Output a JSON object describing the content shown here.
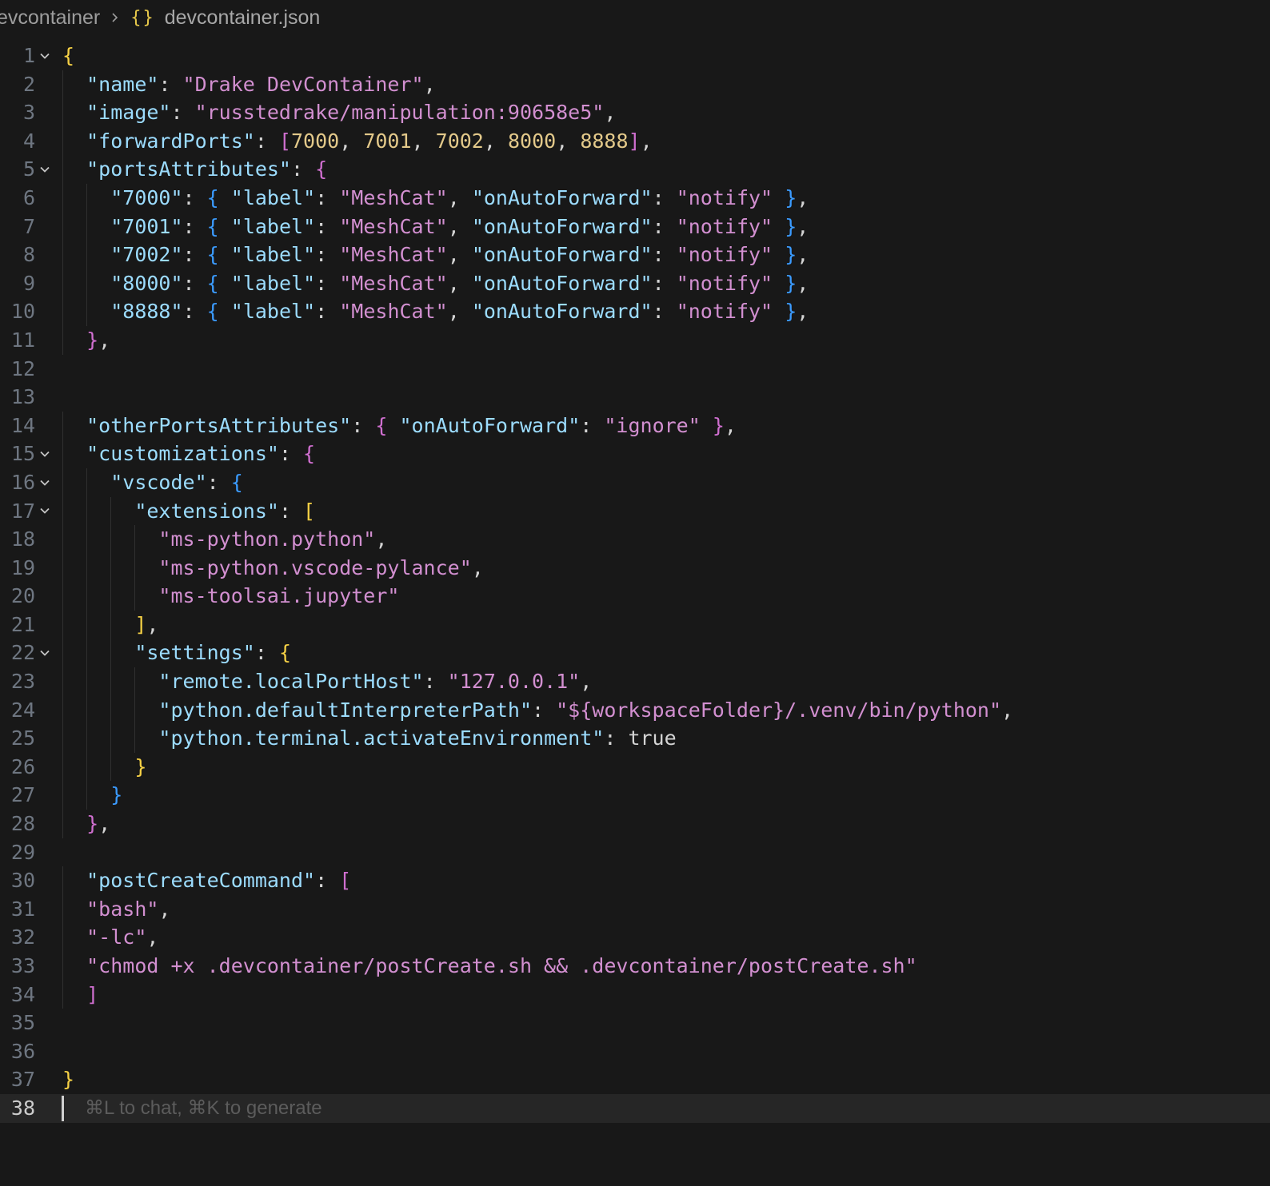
{
  "breadcrumb": {
    "folder": "evcontainer",
    "file_icon": "{}",
    "file": "devcontainer.json"
  },
  "colors": {
    "background": "#181818",
    "key": "#9cdcfe",
    "string": "#d28fd0",
    "number": "#e3c98a",
    "bracket_level1": "#f5d045",
    "bracket_level2": "#d06fd0",
    "bracket_level3": "#3b9bff"
  },
  "editor": {
    "current_line": 38,
    "ghost_hint": "⌘L to chat, ⌘K to generate",
    "lines": [
      {
        "n": "1",
        "fold": true,
        "tokens": [
          [
            "b1",
            "{"
          ]
        ]
      },
      {
        "n": "2",
        "fold": false,
        "tokens": [
          [
            "ind",
            "  "
          ],
          [
            "key",
            "\"name\""
          ],
          [
            "p",
            ": "
          ],
          [
            "s",
            "\"Drake DevContainer\""
          ],
          [
            "p",
            ","
          ]
        ]
      },
      {
        "n": "3",
        "fold": false,
        "tokens": [
          [
            "ind",
            "  "
          ],
          [
            "key",
            "\"image\""
          ],
          [
            "p",
            ": "
          ],
          [
            "s",
            "\"russtedrake/manipulation:90658e5\""
          ],
          [
            "p",
            ","
          ]
        ]
      },
      {
        "n": "4",
        "fold": false,
        "tokens": [
          [
            "ind",
            "  "
          ],
          [
            "key",
            "\"forwardPorts\""
          ],
          [
            "p",
            ": "
          ],
          [
            "b2",
            "["
          ],
          [
            "n",
            "7000"
          ],
          [
            "p",
            ", "
          ],
          [
            "n",
            "7001"
          ],
          [
            "p",
            ", "
          ],
          [
            "n",
            "7002"
          ],
          [
            "p",
            ", "
          ],
          [
            "n",
            "8000"
          ],
          [
            "p",
            ", "
          ],
          [
            "n",
            "8888"
          ],
          [
            "b2",
            "]"
          ],
          [
            "p",
            ","
          ]
        ]
      },
      {
        "n": "5",
        "fold": true,
        "tokens": [
          [
            "ind",
            "  "
          ],
          [
            "key",
            "\"portsAttributes\""
          ],
          [
            "p",
            ": "
          ],
          [
            "b2",
            "{"
          ]
        ]
      },
      {
        "n": "6",
        "fold": false,
        "tokens": [
          [
            "ind",
            "    "
          ],
          [
            "key",
            "\"7000\""
          ],
          [
            "p",
            ": "
          ],
          [
            "b3",
            "{"
          ],
          [
            "p",
            " "
          ],
          [
            "key",
            "\"label\""
          ],
          [
            "p",
            ": "
          ],
          [
            "s",
            "\"MeshCat\""
          ],
          [
            "p",
            ", "
          ],
          [
            "key",
            "\"onAutoForward\""
          ],
          [
            "p",
            ": "
          ],
          [
            "s",
            "\"notify\""
          ],
          [
            "p",
            " "
          ],
          [
            "b3",
            "}"
          ],
          [
            "p",
            ","
          ]
        ]
      },
      {
        "n": "7",
        "fold": false,
        "tokens": [
          [
            "ind",
            "    "
          ],
          [
            "key",
            "\"7001\""
          ],
          [
            "p",
            ": "
          ],
          [
            "b3",
            "{"
          ],
          [
            "p",
            " "
          ],
          [
            "key",
            "\"label\""
          ],
          [
            "p",
            ": "
          ],
          [
            "s",
            "\"MeshCat\""
          ],
          [
            "p",
            ", "
          ],
          [
            "key",
            "\"onAutoForward\""
          ],
          [
            "p",
            ": "
          ],
          [
            "s",
            "\"notify\""
          ],
          [
            "p",
            " "
          ],
          [
            "b3",
            "}"
          ],
          [
            "p",
            ","
          ]
        ]
      },
      {
        "n": "8",
        "fold": false,
        "tokens": [
          [
            "ind",
            "    "
          ],
          [
            "key",
            "\"7002\""
          ],
          [
            "p",
            ": "
          ],
          [
            "b3",
            "{"
          ],
          [
            "p",
            " "
          ],
          [
            "key",
            "\"label\""
          ],
          [
            "p",
            ": "
          ],
          [
            "s",
            "\"MeshCat\""
          ],
          [
            "p",
            ", "
          ],
          [
            "key",
            "\"onAutoForward\""
          ],
          [
            "p",
            ": "
          ],
          [
            "s",
            "\"notify\""
          ],
          [
            "p",
            " "
          ],
          [
            "b3",
            "}"
          ],
          [
            "p",
            ","
          ]
        ]
      },
      {
        "n": "9",
        "fold": false,
        "tokens": [
          [
            "ind",
            "    "
          ],
          [
            "key",
            "\"8000\""
          ],
          [
            "p",
            ": "
          ],
          [
            "b3",
            "{"
          ],
          [
            "p",
            " "
          ],
          [
            "key",
            "\"label\""
          ],
          [
            "p",
            ": "
          ],
          [
            "s",
            "\"MeshCat\""
          ],
          [
            "p",
            ", "
          ],
          [
            "key",
            "\"onAutoForward\""
          ],
          [
            "p",
            ": "
          ],
          [
            "s",
            "\"notify\""
          ],
          [
            "p",
            " "
          ],
          [
            "b3",
            "}"
          ],
          [
            "p",
            ","
          ]
        ]
      },
      {
        "n": "10",
        "fold": false,
        "tokens": [
          [
            "ind",
            "    "
          ],
          [
            "key",
            "\"8888\""
          ],
          [
            "p",
            ": "
          ],
          [
            "b3",
            "{"
          ],
          [
            "p",
            " "
          ],
          [
            "key",
            "\"label\""
          ],
          [
            "p",
            ": "
          ],
          [
            "s",
            "\"MeshCat\""
          ],
          [
            "p",
            ", "
          ],
          [
            "key",
            "\"onAutoForward\""
          ],
          [
            "p",
            ": "
          ],
          [
            "s",
            "\"notify\""
          ],
          [
            "p",
            " "
          ],
          [
            "b3",
            "}"
          ],
          [
            "p",
            ","
          ]
        ]
      },
      {
        "n": "11",
        "fold": false,
        "tokens": [
          [
            "ind",
            "  "
          ],
          [
            "b2",
            "}"
          ],
          [
            "p",
            ","
          ]
        ]
      },
      {
        "n": "12",
        "fold": false,
        "tokens": []
      },
      {
        "n": "13",
        "fold": false,
        "tokens": []
      },
      {
        "n": "14",
        "fold": false,
        "tokens": [
          [
            "ind",
            "  "
          ],
          [
            "key",
            "\"otherPortsAttributes\""
          ],
          [
            "p",
            ": "
          ],
          [
            "b2",
            "{"
          ],
          [
            "p",
            " "
          ],
          [
            "key",
            "\"onAutoForward\""
          ],
          [
            "p",
            ": "
          ],
          [
            "s",
            "\"ignore\""
          ],
          [
            "p",
            " "
          ],
          [
            "b2",
            "}"
          ],
          [
            "p",
            ","
          ]
        ]
      },
      {
        "n": "15",
        "fold": true,
        "tokens": [
          [
            "ind",
            "  "
          ],
          [
            "key",
            "\"customizations\""
          ],
          [
            "p",
            ": "
          ],
          [
            "b2",
            "{"
          ]
        ]
      },
      {
        "n": "16",
        "fold": true,
        "tokens": [
          [
            "ind",
            "    "
          ],
          [
            "key",
            "\"vscode\""
          ],
          [
            "p",
            ": "
          ],
          [
            "b3",
            "{"
          ]
        ]
      },
      {
        "n": "17",
        "fold": true,
        "tokens": [
          [
            "ind",
            "      "
          ],
          [
            "key",
            "\"extensions\""
          ],
          [
            "p",
            ": "
          ],
          [
            "b1",
            "["
          ]
        ]
      },
      {
        "n": "18",
        "fold": false,
        "tokens": [
          [
            "ind",
            "        "
          ],
          [
            "s",
            "\"ms-python.python\""
          ],
          [
            "p",
            ","
          ]
        ]
      },
      {
        "n": "19",
        "fold": false,
        "tokens": [
          [
            "ind",
            "        "
          ],
          [
            "s",
            "\"ms-python.vscode-pylance\""
          ],
          [
            "p",
            ","
          ]
        ]
      },
      {
        "n": "20",
        "fold": false,
        "tokens": [
          [
            "ind",
            "        "
          ],
          [
            "s",
            "\"ms-toolsai.jupyter\""
          ]
        ]
      },
      {
        "n": "21",
        "fold": false,
        "tokens": [
          [
            "ind",
            "      "
          ],
          [
            "b1",
            "]"
          ],
          [
            "p",
            ","
          ]
        ]
      },
      {
        "n": "22",
        "fold": true,
        "tokens": [
          [
            "ind",
            "      "
          ],
          [
            "key",
            "\"settings\""
          ],
          [
            "p",
            ": "
          ],
          [
            "b1",
            "{"
          ]
        ]
      },
      {
        "n": "23",
        "fold": false,
        "tokens": [
          [
            "ind",
            "        "
          ],
          [
            "key",
            "\"remote.localPortHost\""
          ],
          [
            "p",
            ": "
          ],
          [
            "s",
            "\"127.0.0.1\""
          ],
          [
            "p",
            ","
          ]
        ]
      },
      {
        "n": "24",
        "fold": false,
        "tokens": [
          [
            "ind",
            "        "
          ],
          [
            "key",
            "\"python.defaultInterpreterPath\""
          ],
          [
            "p",
            ": "
          ],
          [
            "s",
            "\"${workspaceFolder}/.venv/bin/python\""
          ],
          [
            "p",
            ","
          ]
        ]
      },
      {
        "n": "25",
        "fold": false,
        "tokens": [
          [
            "ind",
            "        "
          ],
          [
            "key",
            "\"python.terminal.activateEnvironment\""
          ],
          [
            "p",
            ": "
          ],
          [
            "kw",
            "true"
          ]
        ]
      },
      {
        "n": "26",
        "fold": false,
        "tokens": [
          [
            "ind",
            "      "
          ],
          [
            "b1",
            "}"
          ]
        ]
      },
      {
        "n": "27",
        "fold": false,
        "tokens": [
          [
            "ind",
            "    "
          ],
          [
            "b3",
            "}"
          ]
        ]
      },
      {
        "n": "28",
        "fold": false,
        "tokens": [
          [
            "ind",
            "  "
          ],
          [
            "b2",
            "}"
          ],
          [
            "p",
            ","
          ]
        ]
      },
      {
        "n": "29",
        "fold": false,
        "tokens": []
      },
      {
        "n": "30",
        "fold": false,
        "tokens": [
          [
            "ind",
            "  "
          ],
          [
            "key",
            "\"postCreateCommand\""
          ],
          [
            "p",
            ": "
          ],
          [
            "b2",
            "["
          ]
        ]
      },
      {
        "n": "31",
        "fold": false,
        "tokens": [
          [
            "ind",
            "  "
          ],
          [
            "s",
            "\"bash\""
          ],
          [
            "p",
            ","
          ]
        ]
      },
      {
        "n": "32",
        "fold": false,
        "tokens": [
          [
            "ind",
            "  "
          ],
          [
            "s",
            "\"-lc\""
          ],
          [
            "p",
            ","
          ]
        ]
      },
      {
        "n": "33",
        "fold": false,
        "tokens": [
          [
            "ind",
            "  "
          ],
          [
            "s",
            "\"chmod +x .devcontainer/postCreate.sh && .devcontainer/postCreate.sh\""
          ]
        ]
      },
      {
        "n": "34",
        "fold": false,
        "tokens": [
          [
            "ind",
            "  "
          ],
          [
            "b2",
            "]"
          ]
        ]
      },
      {
        "n": "35",
        "fold": false,
        "tokens": []
      },
      {
        "n": "36",
        "fold": false,
        "tokens": []
      },
      {
        "n": "37",
        "fold": false,
        "tokens": [
          [
            "b1",
            "}"
          ]
        ]
      },
      {
        "n": "38",
        "fold": false,
        "tokens": []
      }
    ]
  }
}
